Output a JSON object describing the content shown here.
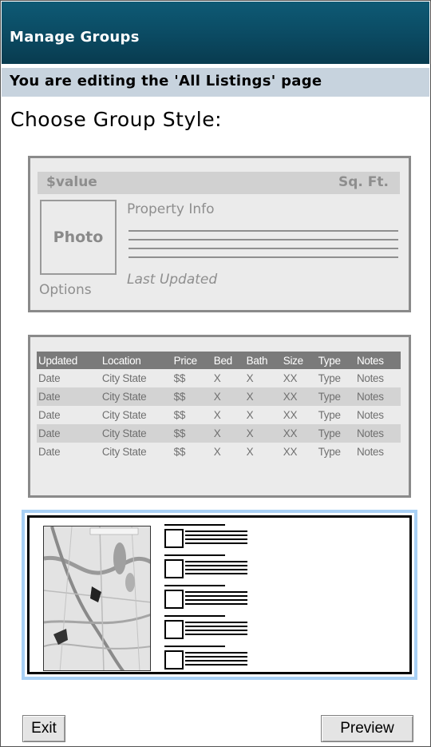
{
  "header": {
    "title": "Manage Groups",
    "editing_notice": "You are editing the 'All Listings' page"
  },
  "main": {
    "heading": "Choose Group Style:",
    "style_options": [
      {
        "kind": "detail-card",
        "value_label": "$value",
        "sqft_label": "Sq. Ft.",
        "photo_label": "Photo",
        "property_info_label": "Property Info",
        "last_updated_label": "Last Updated",
        "options_label": "Options"
      },
      {
        "kind": "table",
        "columns": [
          "Updated",
          "Location",
          "Price",
          "Bed",
          "Bath",
          "Size",
          "Type",
          "Notes"
        ],
        "rows": [
          [
            "Date",
            "City State",
            "$$",
            "X",
            "X",
            "XX",
            "Type",
            "Notes"
          ],
          [
            "Date",
            "City State",
            "$$",
            "X",
            "X",
            "XX",
            "Type",
            "Notes"
          ],
          [
            "Date",
            "City State",
            "$$",
            "X",
            "X",
            "XX",
            "Type",
            "Notes"
          ],
          [
            "Date",
            "City State",
            "$$",
            "X",
            "X",
            "XX",
            "Type",
            "Notes"
          ],
          [
            "Date",
            "City State",
            "$$",
            "X",
            "X",
            "XX",
            "Type",
            "Notes"
          ]
        ]
      },
      {
        "kind": "map-list",
        "selected": true,
        "map_icon": "map-thumbnail-icon",
        "list_rows": 5
      }
    ]
  },
  "footer": {
    "exit_label": "Exit",
    "preview_label": "Preview"
  },
  "colors": {
    "titlebar": "#0b4a62",
    "editing_bar": "#c7d3de",
    "selection_border": "#a8d0f5",
    "table_header": "#7a7a7a",
    "placeholder_text": "#8e8e8e"
  }
}
